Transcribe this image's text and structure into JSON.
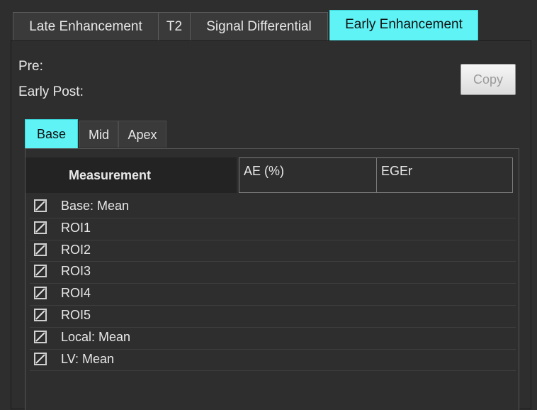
{
  "tabs": [
    {
      "label": "Late Enhancement",
      "active": false
    },
    {
      "label": "T2",
      "active": false
    },
    {
      "label": "Signal Differential",
      "active": false
    },
    {
      "label": "Early Enhancement",
      "active": true
    }
  ],
  "panel": {
    "pre_label": "Pre:",
    "early_post_label": "Early Post:",
    "copy_label": "Copy"
  },
  "subtabs": [
    {
      "label": "Base",
      "active": true
    },
    {
      "label": "Mid",
      "active": false
    },
    {
      "label": "Apex",
      "active": false
    }
  ],
  "table": {
    "headers": [
      "Measurement",
      "AE (%)",
      "EGEr"
    ],
    "rows": [
      {
        "label": "Base: Mean",
        "checked": true
      },
      {
        "label": "ROI1",
        "checked": true
      },
      {
        "label": "ROI2",
        "checked": true
      },
      {
        "label": "ROI3",
        "checked": true
      },
      {
        "label": "ROI4",
        "checked": true
      },
      {
        "label": "ROI5",
        "checked": true
      },
      {
        "label": "Local: Mean",
        "checked": true
      },
      {
        "label": "LV: Mean",
        "checked": true
      }
    ]
  },
  "colors": {
    "active_tab": "#5ff3f6",
    "background": "#2e2e2e"
  }
}
